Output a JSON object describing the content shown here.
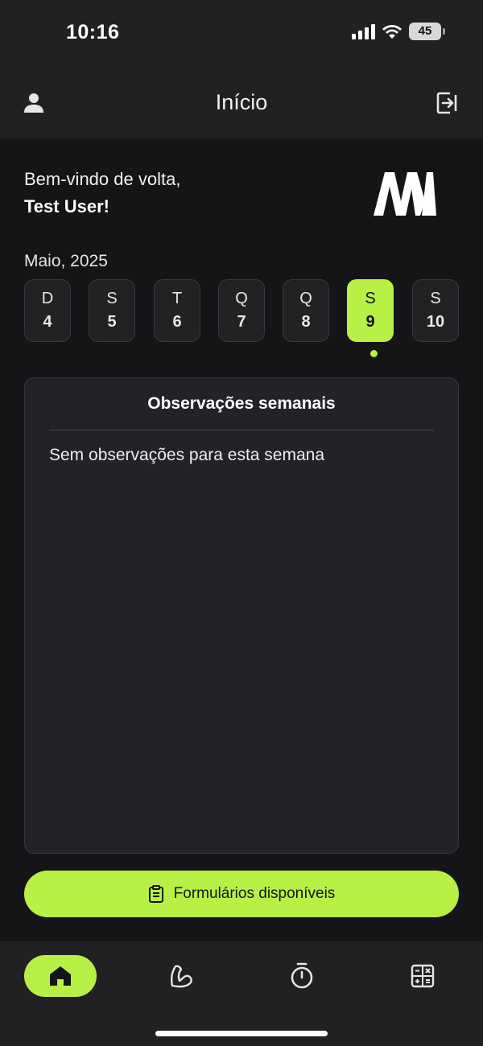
{
  "status_bar": {
    "time": "10:16",
    "battery": "45"
  },
  "header": {
    "title": "Início"
  },
  "greeting": {
    "line1": "Bem-vindo de volta,",
    "line2": "Test User!"
  },
  "calendar": {
    "month": "Maio, 2025",
    "days": [
      {
        "letter": "D",
        "number": "4"
      },
      {
        "letter": "S",
        "number": "5"
      },
      {
        "letter": "T",
        "number": "6"
      },
      {
        "letter": "Q",
        "number": "7"
      },
      {
        "letter": "Q",
        "number": "8"
      },
      {
        "letter": "S",
        "number": "9"
      },
      {
        "letter": "S",
        "number": "10"
      }
    ],
    "selected_index": 5
  },
  "observations": {
    "title": "Observações semanais",
    "empty_text": "Sem observações para esta semana"
  },
  "forms_button": {
    "label": "Formulários disponíveis",
    "icon": "clipboard-icon"
  },
  "bottom_nav": {
    "items": [
      {
        "icon": "home-icon",
        "active": true
      },
      {
        "icon": "arm-muscle-icon",
        "active": false
      },
      {
        "icon": "stopwatch-icon",
        "active": false
      },
      {
        "icon": "calculator-icon",
        "active": false
      }
    ]
  },
  "colors": {
    "accent": "#b8f045",
    "background": "#151517",
    "surface": "#212124",
    "card": "#232327"
  }
}
